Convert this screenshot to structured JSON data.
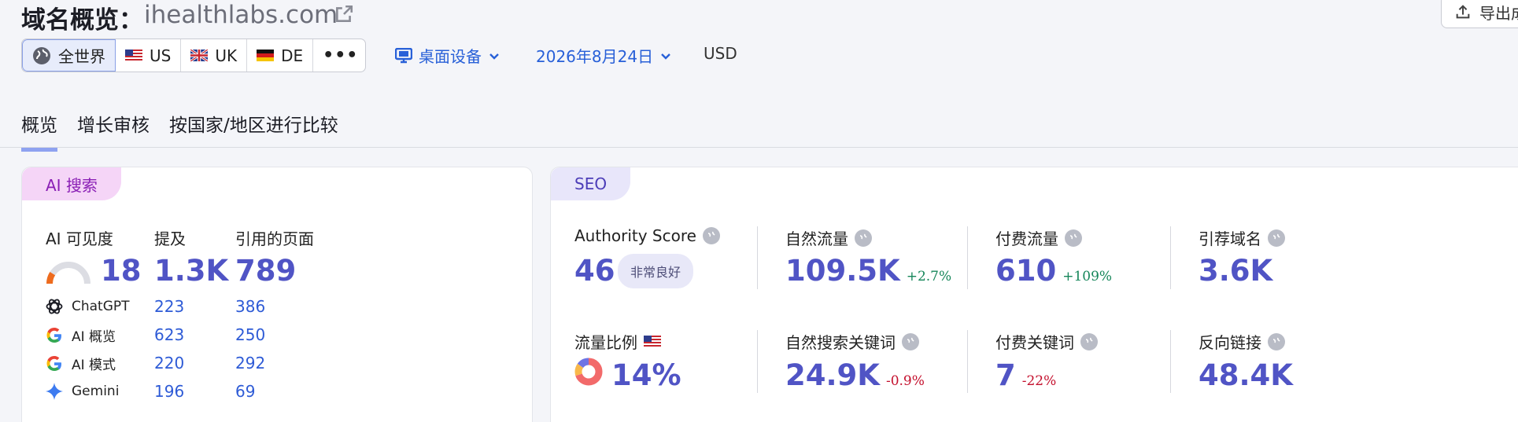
{
  "header": {
    "title": "域名概览：",
    "domain": "ihealthlabs.com",
    "export_label": "导出成"
  },
  "regions": [
    {
      "label": "全世界",
      "icon": "globe-icon",
      "active": true
    },
    {
      "label": "US",
      "icon": "us-flag-icon"
    },
    {
      "label": "UK",
      "icon": "uk-flag-icon"
    },
    {
      "label": "DE",
      "icon": "de-flag-icon"
    }
  ],
  "more_label": "•••",
  "device": "桌面设备",
  "date": "2026年8月24日",
  "currency": "USD",
  "tabs": [
    "概览",
    "增长审核",
    "按国家/地区进行比较"
  ],
  "ai_card": {
    "badge": "AI 搜索",
    "col_visibility": "AI 可见度",
    "col_mentions": "提及",
    "col_cited": "引用的页面",
    "visibility_score": "18",
    "visibility_level": 0.18,
    "mentions_total": "1.3K",
    "cited_total": "789",
    "rows": [
      {
        "label": "ChatGPT",
        "icon": "chatgpt-icon",
        "mentions": "223",
        "cited": "386"
      },
      {
        "label": "AI 概览",
        "icon": "google-icon",
        "mentions": "623",
        "cited": "250"
      },
      {
        "label": "AI 模式",
        "icon": "google-icon",
        "mentions": "220",
        "cited": "292"
      },
      {
        "label": "Gemini",
        "icon": "gemini-icon",
        "mentions": "196",
        "cited": "69"
      }
    ]
  },
  "seo_card": {
    "badge": "SEO",
    "authority_label": "Authority Score",
    "authority_value": "46",
    "authority_pill": "非常良好",
    "organic_label": "自然流量",
    "organic_value": "109.5K",
    "organic_delta": "+2.7%",
    "paid_label": "付费流量",
    "paid_value": "610",
    "paid_delta": "+109%",
    "ref_domains_label": "引荐域名",
    "ref_domains_value": "3.6K",
    "share_label": "流量比例",
    "share_value": "14%",
    "organic_kw_label": "自然搜索关键词",
    "organic_kw_value": "24.9K",
    "organic_kw_delta": "-0.9%",
    "paid_kw_label": "付费关键词",
    "paid_kw_value": "7",
    "paid_kw_delta": "-22%",
    "backlinks_label": "反向链接",
    "backlinks_value": "48.4K"
  },
  "colors": {
    "accent": "#5054c5",
    "link": "#2860d8",
    "positive": "#16865a",
    "negative": "#c4102d"
  }
}
